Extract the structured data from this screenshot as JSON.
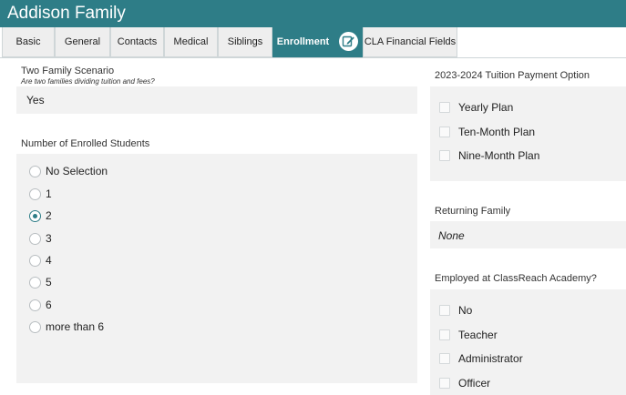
{
  "window": {
    "title": "Addison Family"
  },
  "tabs": [
    {
      "label": "Basic"
    },
    {
      "label": "General"
    },
    {
      "label": "Contacts"
    },
    {
      "label": "Medical"
    },
    {
      "label": "Siblings"
    },
    {
      "label": "Enrollment",
      "active": true
    },
    {
      "icon": "edit-note-icon"
    },
    {
      "label": "CLA Financial Fields"
    }
  ],
  "two_family": {
    "label": "Two Family Scenario",
    "help": "Are two families dividing tuition and fees?",
    "value": "Yes"
  },
  "enrolled_students": {
    "label": "Number of Enrolled Students",
    "options": [
      "No Selection",
      "1",
      "2",
      "3",
      "4",
      "5",
      "6",
      "more than 6"
    ],
    "selected": "2"
  },
  "tuition_option": {
    "label": "2023-2024 Tuition Payment Option",
    "options": [
      "Yearly Plan",
      "Ten-Month Plan",
      "Nine-Month Plan"
    ]
  },
  "returning_family": {
    "label": "Returning Family",
    "value": "None"
  },
  "employed": {
    "label": "Employed at ClassReach Academy?",
    "options": [
      "No",
      "Teacher",
      "Administrator",
      "Officer"
    ]
  },
  "colors": {
    "accent": "#2e7d87",
    "panel": "#f2f2f2"
  }
}
